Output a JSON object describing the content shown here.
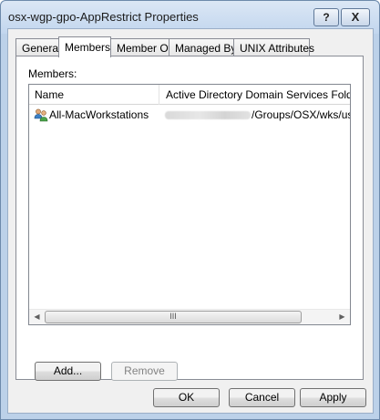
{
  "window": {
    "title": "osx-wgp-gpo-AppRestrict Properties",
    "help_label": "?",
    "close_label": "X"
  },
  "tabs": [
    {
      "label": "General",
      "active": false
    },
    {
      "label": "Members",
      "active": true
    },
    {
      "label": "Member Of",
      "active": false
    },
    {
      "label": "Managed By",
      "active": false
    },
    {
      "label": "UNIX Attributes",
      "active": false
    }
  ],
  "members": {
    "label": "Members:",
    "columns": [
      "Name",
      "Active Directory Domain Services Folder"
    ],
    "rows": [
      {
        "name": "All-MacWorkstations",
        "folder": "/Groups/OSX/wks/usa",
        "icon": "group-icon"
      }
    ],
    "scroll_thumb_grip": "III"
  },
  "buttons": {
    "add": "Add...",
    "remove": "Remove",
    "ok": "OK",
    "cancel": "Cancel",
    "apply": "Apply"
  }
}
